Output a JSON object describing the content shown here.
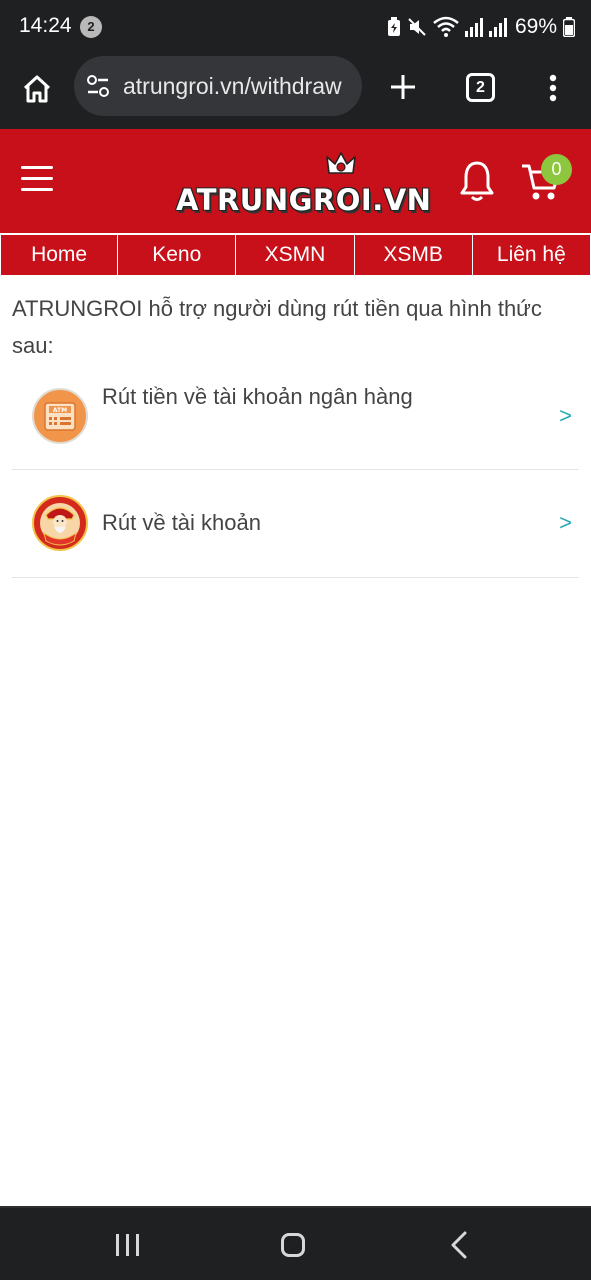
{
  "status_bar": {
    "time": "14:24",
    "notification_count": "2",
    "battery": "69%"
  },
  "browser": {
    "url": "atrungroi.vn/withdraw",
    "tab_count": "2"
  },
  "site": {
    "logo_text": "ATRUNGROI.VN",
    "cart_count": "0",
    "brand_color": "#c8101a",
    "badge_color": "#8dc63f"
  },
  "nav": {
    "tabs": [
      {
        "label": "Home"
      },
      {
        "label": "Keno"
      },
      {
        "label": "XSMN"
      },
      {
        "label": "XSMB"
      },
      {
        "label": "Liên hệ"
      }
    ]
  },
  "content": {
    "intro": "ATRUNGROI hỗ trợ người dùng rút tiền qua hình thức sau:",
    "options": [
      {
        "label": "Rút tiền về tài khoản ngân hàng",
        "icon": "atm-icon",
        "icon_text": "ATM",
        "arrow": ">"
      },
      {
        "label": "Rút về tài khoản",
        "icon": "god-of-wealth-icon",
        "arrow": ">"
      }
    ]
  }
}
